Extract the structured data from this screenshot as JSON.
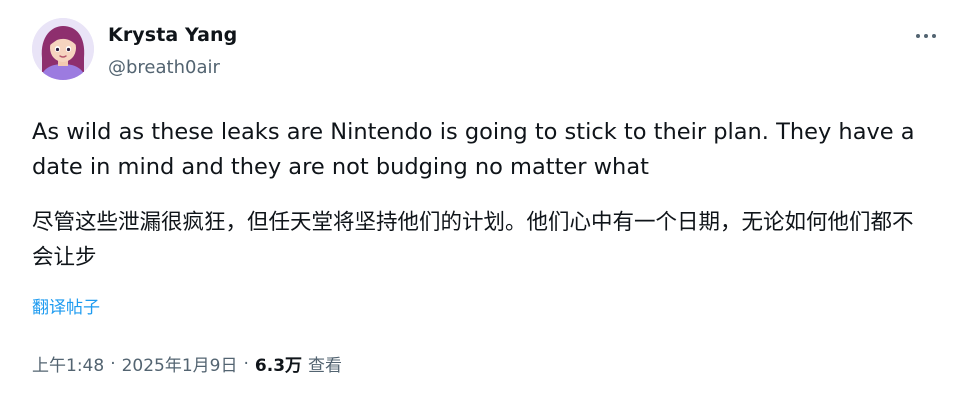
{
  "author": {
    "display_name": "Krysta Yang",
    "handle": "@breath0air",
    "avatar_icon": "cartoon-avatar-purple-hair"
  },
  "more_icon": "more-horizontal-icon",
  "tweet": {
    "text_en": "As wild as these leaks are Nintendo is going to stick to their plan. They have a date in mind and they are not budging no matter what",
    "text_zh": "尽管这些泄漏很疯狂，但任天堂将坚持他们的计划。他们心中有一个日期，无论如何他们都不会让步",
    "translate_label": "翻译帖子"
  },
  "meta": {
    "time": "上午1:48",
    "separator": "·",
    "date": "2025年1月9日",
    "views_count": "6.3万",
    "views_label": "查看"
  },
  "colors": {
    "text_primary": "#0f1419",
    "text_secondary": "#536471",
    "link": "#1d9bf0"
  }
}
